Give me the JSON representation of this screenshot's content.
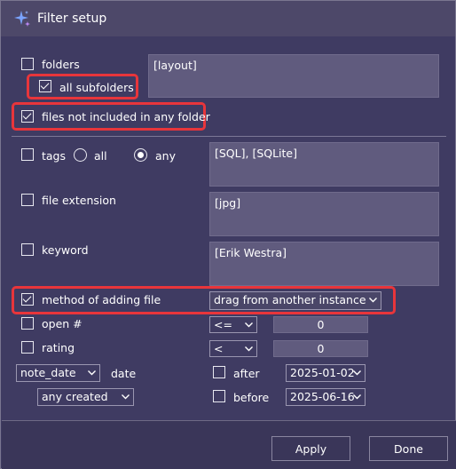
{
  "window": {
    "title": "Filter setup"
  },
  "folders": {
    "label": "folders",
    "checked": false,
    "value": "[layout]",
    "all_subfolders": {
      "label": "all subfolders",
      "checked": true
    }
  },
  "files_not_in_folder": {
    "label": "files not included in any folder",
    "checked": true
  },
  "tags": {
    "label": "tags",
    "checked": false,
    "radio_all": "all",
    "radio_any": "any",
    "selected": "any",
    "value": "[SQL], [SQLite]"
  },
  "file_extension": {
    "label": "file extension",
    "checked": false,
    "value": "[jpg]"
  },
  "keyword": {
    "label": "keyword",
    "checked": false,
    "value": "[Erik Westra]"
  },
  "method": {
    "label": "method of adding file",
    "checked": true,
    "value": "drag from another instance"
  },
  "open_count": {
    "label": "open #",
    "checked": false,
    "operator": "<=",
    "value": "0"
  },
  "rating": {
    "label": "rating",
    "checked": false,
    "operator": "<",
    "value": "0"
  },
  "date": {
    "field": "note_date",
    "label": "date",
    "mode": "any created",
    "after": {
      "label": "after",
      "checked": false,
      "value": "2025-01-02"
    },
    "before": {
      "label": "before",
      "checked": false,
      "value": "2025-06-16"
    }
  },
  "buttons": {
    "apply": "Apply",
    "done": "Done"
  },
  "colors": {
    "background": "#3f3b62",
    "titlebar": "#4d4869",
    "highlight": "#e8353b",
    "field": "#605b7e"
  }
}
